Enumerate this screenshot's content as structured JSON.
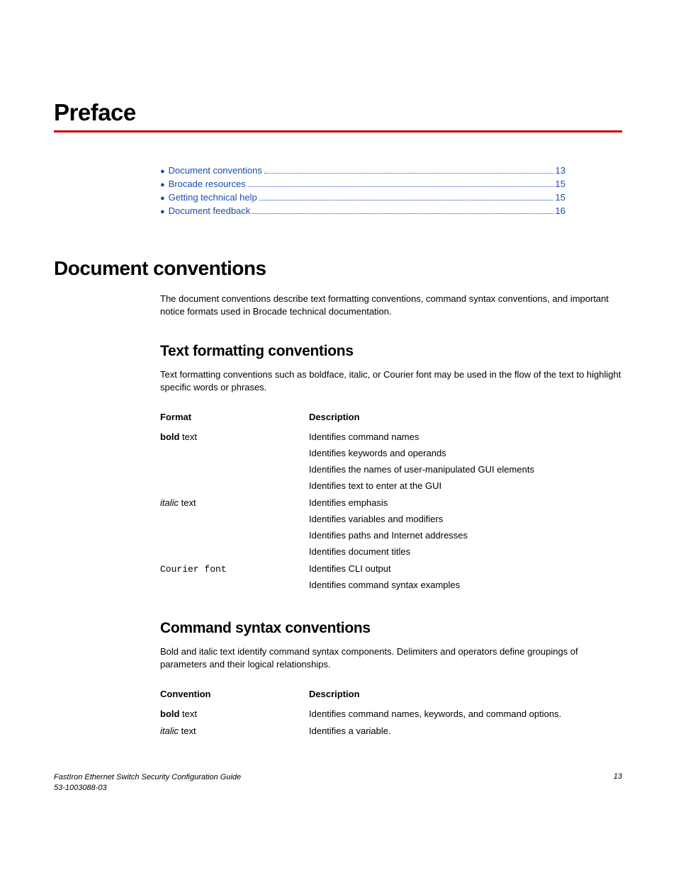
{
  "title": "Preface",
  "toc": [
    {
      "label": "Document conventions",
      "page": "13"
    },
    {
      "label": "Brocade resources",
      "page": "15"
    },
    {
      "label": "Getting technical help",
      "page": "15"
    },
    {
      "label": "Document feedback",
      "page": "16"
    }
  ],
  "sections": {
    "docconv": {
      "heading": "Document conventions",
      "intro": "The document conventions describe text formatting conventions, command syntax conventions, and important notice formats used in Brocade technical documentation."
    },
    "textfmt": {
      "heading": "Text formatting conventions",
      "intro": "Text formatting conventions such as boldface, italic, or Courier font may be used in the flow of the text to highlight specific words or phrases.",
      "table_headers": {
        "col1": "Format",
        "col2": "Description"
      },
      "rows": [
        {
          "format_bold": "bold",
          "format_rest": " text",
          "desc": [
            "Identifies command names",
            "Identifies keywords and operands",
            "Identifies the names of user-manipulated GUI elements",
            "Identifies text to enter at the GUI"
          ]
        },
        {
          "format_italic": "italic",
          "format_rest": " text",
          "desc": [
            "Identifies emphasis",
            "Identifies variables and modifiers",
            "Identifies paths and Internet addresses",
            "Identifies document titles"
          ]
        },
        {
          "format_mono": "Courier font",
          "desc": [
            "Identifies CLI output",
            "Identifies command syntax examples"
          ]
        }
      ]
    },
    "cmdsyn": {
      "heading": "Command syntax conventions",
      "intro": "Bold and italic text identify command syntax components. Delimiters and operators define groupings of parameters and their logical relationships.",
      "table_headers": {
        "col1": "Convention",
        "col2": "Description"
      },
      "rows": [
        {
          "format_bold": "bold",
          "format_rest": " text",
          "desc": [
            "Identifies command names, keywords, and command options."
          ]
        },
        {
          "format_italic": "italic",
          "format_rest": " text",
          "desc": [
            "Identifies a variable."
          ]
        }
      ]
    }
  },
  "footer": {
    "title": "FastIron Ethernet Switch Security Configuration Guide",
    "docnum": "53-1003088-03",
    "pagenum": "13"
  }
}
